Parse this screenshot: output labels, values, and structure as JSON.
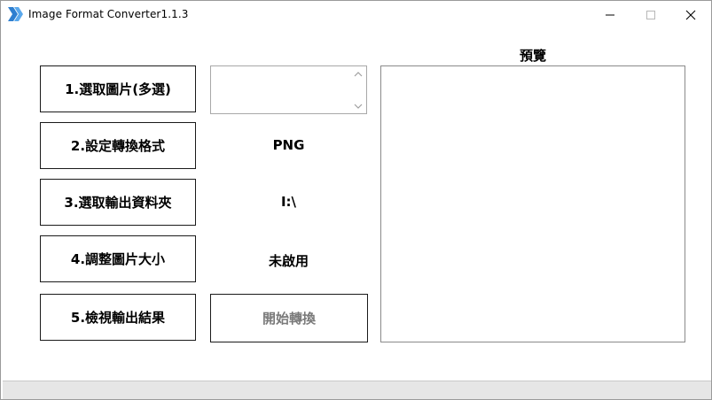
{
  "window": {
    "title": "Image Format Converter1.1.3",
    "controls": {
      "minimize_icon": "minimize-icon",
      "maximize_icon": "maximize-icon",
      "close_icon": "close-icon"
    }
  },
  "actions": {
    "select_images": "1.選取圖片(多選)",
    "set_format": "2.設定轉換格式",
    "select_output_folder": "3.選取輸出資料夾",
    "resize_images": "4.調整圖片大小",
    "view_results": "5.檢視輸出結果"
  },
  "values": {
    "selected_files": "",
    "format": "PNG",
    "output_folder": "I:\\",
    "resize_status": "未啟用"
  },
  "start_button": {
    "label": "開始轉換",
    "enabled": false
  },
  "preview": {
    "title": "預覽"
  },
  "colors": {
    "app_icon": "#3b8fd8",
    "disabled_text": "#7a7a7a",
    "statusbar": "#e6e6e6"
  }
}
